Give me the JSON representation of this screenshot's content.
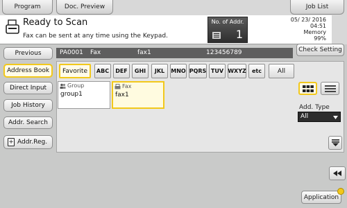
{
  "tabs": {
    "program": "Program",
    "doc_preview": "Doc. Preview",
    "job_list": "Job List"
  },
  "status": {
    "title": "Ready to Scan",
    "subtitle": "Fax can be sent at any time using the Keypad."
  },
  "addr_count": {
    "label": "No. of Addr.",
    "value": "1"
  },
  "datetime": {
    "date": "05/ 23/ 2016",
    "time": "04:51",
    "memory_label": "Memory",
    "memory_value": "99%"
  },
  "nav": {
    "previous": "Previous",
    "address_book": "Address Book",
    "direct_input": "Direct Input",
    "job_history": "Job History",
    "addr_search": "Addr. Search",
    "addr_reg": "Addr.Reg."
  },
  "destination": {
    "id": "PA0001",
    "type": "Fax",
    "name": "fax1",
    "number": "123456789"
  },
  "check_setting": "Check Setting",
  "index_tabs": {
    "favorite": "Favorite",
    "letters": [
      "ABC",
      "DEF",
      "GHI",
      "JKL",
      "MNO",
      "PQRS",
      "TUV",
      "WXYZ",
      "etc"
    ],
    "all": "All"
  },
  "entries": [
    {
      "type": "Group",
      "name": "group1"
    },
    {
      "type": "Fax",
      "name": "fax1"
    }
  ],
  "addr_type": {
    "label": "Add. Type",
    "value": "All"
  },
  "application": "Application",
  "colors": {
    "accent_yellow": "#f2c81b",
    "dark_bar": "#5e5e5e"
  }
}
